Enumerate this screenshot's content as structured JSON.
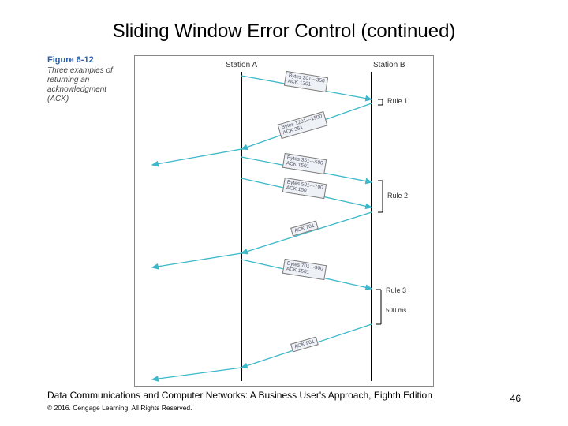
{
  "title": "Sliding Window Error Control (continued)",
  "figure": {
    "label": "Figure 6-12",
    "caption": "Three examples of returning an acknowledgment (ACK)",
    "stationA": "Station A",
    "stationB": "Station B",
    "packets": {
      "p1l1": "Bytes 201---350",
      "p1l2": "ACK 1201",
      "p2l1": "Bytes 1201---1500",
      "p2l2": "ACK 351",
      "p3l1": "Bytes 351---500",
      "p3l2": "ACK 1501",
      "p4l1": "Bytes 501---700",
      "p4l2": "ACK 1501",
      "p5l1": "ACK 701",
      "p6l1": "Bytes 701---900",
      "p6l2": "ACK 1501",
      "p7l1": "ACK 901"
    },
    "rules": {
      "r1": "Rule 1",
      "r2": "Rule 2",
      "r3": "Rule 3"
    },
    "timer": "500 ms"
  },
  "footer": {
    "book": "Data Communications and Computer Networks: A Business User's Approach, Eighth Edition",
    "page": "46",
    "copy": "© 2016. Cengage Learning. All Rights Reserved."
  },
  "colors": {
    "arrow": "#3bb8c9",
    "timeline": "#000"
  }
}
